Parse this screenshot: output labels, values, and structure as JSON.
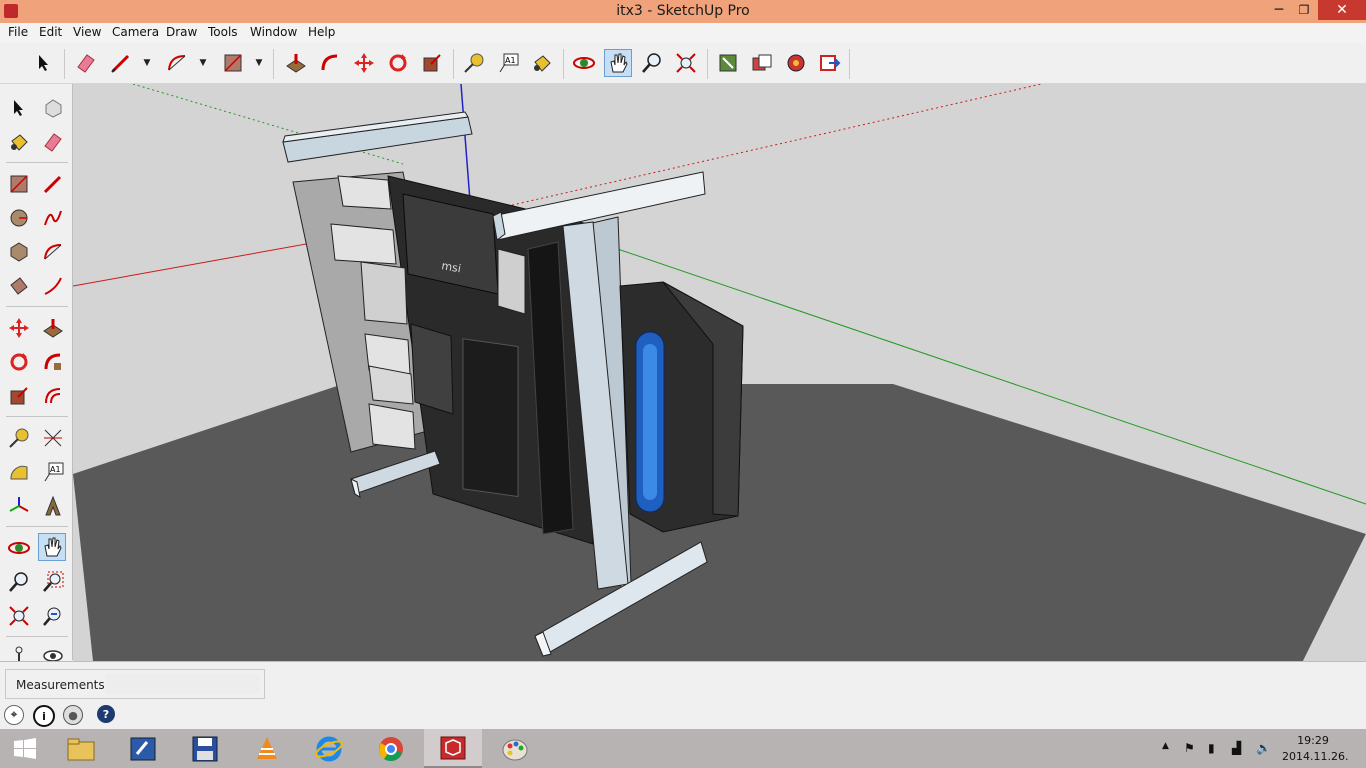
{
  "window": {
    "title": "itx3 - SketchUp Pro",
    "minimize": "─",
    "maximize": "❐",
    "close": "✕"
  },
  "menu": [
    "File",
    "Edit",
    "View",
    "Camera",
    "Draw",
    "Tools",
    "Window",
    "Help"
  ],
  "toolbar": {
    "icons": [
      "select-icon",
      "eraser-icon",
      "pencil-line-icon",
      "arc-icon",
      "rectangle-icon",
      "push-pull-icon",
      "follow-me-icon",
      "move-icon",
      "rotate-icon",
      "scale-icon",
      "tape-measure-icon",
      "text-icon",
      "paint-bucket-icon",
      "orbit-icon",
      "pan-icon",
      "zoom-icon",
      "zoom-extents-icon",
      "model-info-icon",
      "components-icon",
      "extension-warehouse-icon",
      "send-to-layout-icon"
    ],
    "active": "pan-icon"
  },
  "left_toolbar": {
    "icons": [
      "select-icon",
      "make-component-icon",
      "paint-bucket-icon",
      "eraser-icon",
      "rectangle-icon",
      "line-icon",
      "circle-icon",
      "freehand-icon",
      "polygon-icon",
      "arc-icon",
      "rotated-rectangle-icon",
      "two-point-arc-icon",
      "move-icon",
      "push-pull-icon",
      "rotate-icon",
      "follow-me-icon",
      "scale-icon",
      "offset-icon",
      "tape-measure-icon",
      "dimensions-icon",
      "protractor-icon",
      "text-icon",
      "axes-icon",
      "3d-text-icon",
      "orbit-icon",
      "pan-icon",
      "zoom-icon",
      "zoom-window-icon",
      "zoom-extents-icon",
      "previous-view-icon",
      "walk-icon",
      "look-around-icon"
    ],
    "active": "pan-icon"
  },
  "status": {
    "measurements_label": "Measurements",
    "measurements_value": "",
    "icons": [
      "geo-location-icon",
      "credits-icon",
      "user-account-icon",
      "help-icon"
    ]
  },
  "taskbar": {
    "buttons": [
      "windows-start-icon",
      "file-explorer-icon",
      "blue-app-icon",
      "save-floppy-icon",
      "vlc-icon",
      "internet-explorer-icon",
      "chrome-icon",
      "sketchup-icon",
      "paint-icon"
    ],
    "active": "sketchup-icon",
    "time": "19:29",
    "date": "2014.11.26."
  },
  "colors": {
    "titlebar": "#f0a37a",
    "close_button": "#c7382f",
    "sky": "#d4d4d4",
    "ground": "#595959",
    "axis_red": "#cc1b1b",
    "axis_green": "#1f9a1f",
    "axis_blue": "#2222c8"
  }
}
